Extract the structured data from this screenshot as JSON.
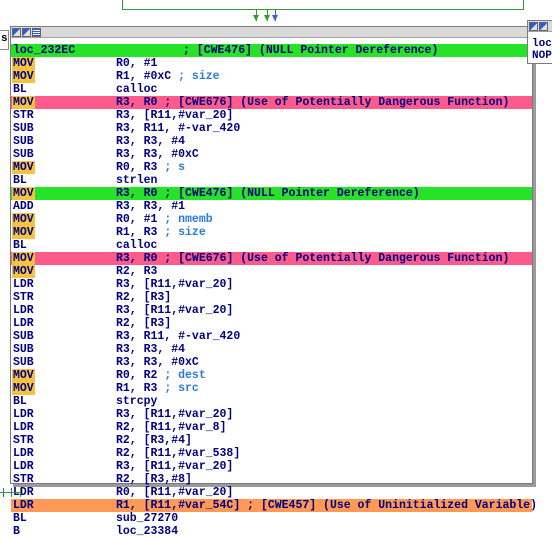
{
  "left_node": {
    "label": "s"
  },
  "main_node": {
    "lines": [
      {
        "mnemonic": "loc_232EC",
        "operand": "",
        "comment": "; [CWE476] (NULL Pointer Dereference)",
        "highlight": "green",
        "is_label": true
      },
      {
        "mnemonic": "MOV",
        "operand": "R0, #1",
        "comment": "",
        "highlight": "none",
        "mnem_box": true
      },
      {
        "mnemonic": "MOV",
        "operand": "R1, #0xC",
        "comment": "; size",
        "highlight": "none",
        "mnem_box": true
      },
      {
        "mnemonic": "BL",
        "operand": "calloc",
        "comment": "",
        "highlight": "none"
      },
      {
        "mnemonic": "MOV",
        "operand": "R3, R0",
        "comment": "; [CWE676] (Use of Potentially Dangerous Function)",
        "highlight": "pink",
        "mnem_box": true
      },
      {
        "mnemonic": "STR",
        "operand": "R3, [R11,#var_20]",
        "comment": "",
        "highlight": "none"
      },
      {
        "mnemonic": "SUB",
        "operand": "R3, R11, #-var_420",
        "comment": "",
        "highlight": "none"
      },
      {
        "mnemonic": "SUB",
        "operand": "R3, R3, #4",
        "comment": "",
        "highlight": "none"
      },
      {
        "mnemonic": "SUB",
        "operand": "R3, R3, #0xC",
        "comment": "",
        "highlight": "none"
      },
      {
        "mnemonic": "MOV",
        "operand": "R0, R3",
        "comment": "; s",
        "highlight": "none",
        "mnem_box": true
      },
      {
        "mnemonic": "BL",
        "operand": "strlen",
        "comment": "",
        "highlight": "none"
      },
      {
        "mnemonic": "MOV",
        "operand": "R3, R0",
        "comment": "; [CWE476] (NULL Pointer Dereference)",
        "highlight": "green",
        "mnem_box": true
      },
      {
        "mnemonic": "ADD",
        "operand": "R3, R3, #1",
        "comment": "",
        "highlight": "none"
      },
      {
        "mnemonic": "MOV",
        "operand": "R0, #1",
        "comment": "; nmemb",
        "highlight": "none",
        "mnem_box": true
      },
      {
        "mnemonic": "MOV",
        "operand": "R1, R3",
        "comment": "; size",
        "highlight": "none",
        "mnem_box": true
      },
      {
        "mnemonic": "BL",
        "operand": "calloc",
        "comment": "",
        "highlight": "none"
      },
      {
        "mnemonic": "MOV",
        "operand": "R3, R0",
        "comment": "; [CWE676] (Use of Potentially Dangerous Function)",
        "highlight": "pink",
        "mnem_box": true
      },
      {
        "mnemonic": "MOV",
        "operand": "R2, R3",
        "comment": "",
        "highlight": "none",
        "mnem_box": true
      },
      {
        "mnemonic": "LDR",
        "operand": "R3, [R11,#var_20]",
        "comment": "",
        "highlight": "none"
      },
      {
        "mnemonic": "STR",
        "operand": "R2, [R3]",
        "comment": "",
        "highlight": "none"
      },
      {
        "mnemonic": "LDR",
        "operand": "R3, [R11,#var_20]",
        "comment": "",
        "highlight": "none"
      },
      {
        "mnemonic": "LDR",
        "operand": "R2, [R3]",
        "comment": "",
        "highlight": "none"
      },
      {
        "mnemonic": "SUB",
        "operand": "R3, R11, #-var_420",
        "comment": "",
        "highlight": "none"
      },
      {
        "mnemonic": "SUB",
        "operand": "R3, R3, #4",
        "comment": "",
        "highlight": "none"
      },
      {
        "mnemonic": "SUB",
        "operand": "R3, R3, #0xC",
        "comment": "",
        "highlight": "none"
      },
      {
        "mnemonic": "MOV",
        "operand": "R0, R2",
        "comment": "; dest",
        "highlight": "none",
        "mnem_box": true
      },
      {
        "mnemonic": "MOV",
        "operand": "R1, R3",
        "comment": "; src",
        "highlight": "none",
        "mnem_box": true
      },
      {
        "mnemonic": "BL",
        "operand": "strcpy",
        "comment": "",
        "highlight": "none"
      },
      {
        "mnemonic": "LDR",
        "operand": "R3, [R11,#var_20]",
        "comment": "",
        "highlight": "none"
      },
      {
        "mnemonic": "LDR",
        "operand": "R2, [R11,#var_8]",
        "comment": "",
        "highlight": "none"
      },
      {
        "mnemonic": "STR",
        "operand": "R2, [R3,#4]",
        "comment": "",
        "highlight": "none"
      },
      {
        "mnemonic": "LDR",
        "operand": "R2, [R11,#var_538]",
        "comment": "",
        "highlight": "none"
      },
      {
        "mnemonic": "LDR",
        "operand": "R3, [R11,#var_20]",
        "comment": "",
        "highlight": "none"
      },
      {
        "mnemonic": "STR",
        "operand": "R2, [R3,#8]",
        "comment": "",
        "highlight": "none"
      },
      {
        "mnemonic": "LDR",
        "operand": "R0, [R11,#var_20]",
        "comment": "",
        "highlight": "none"
      },
      {
        "mnemonic": "LDR",
        "operand": "R1, [R11,#var_54C]",
        "comment": "; [CWE457] (Use of Uninitialized Variable)",
        "highlight": "orange"
      },
      {
        "mnemonic": "BL",
        "operand": "sub_27270",
        "comment": "",
        "highlight": "none"
      },
      {
        "mnemonic": "B",
        "operand": "loc_23384",
        "comment": "",
        "highlight": "none"
      }
    ]
  },
  "right_node": {
    "lines": [
      "loc_",
      "NOP"
    ]
  },
  "colors": {
    "green": "#27e327",
    "pink": "#ff5a8c",
    "orange": "#ff9955",
    "edge_green": "#2e9c2e",
    "edge_blue": "#3a5fcd"
  },
  "icons": [
    "node-color-icon",
    "node-graph-icon",
    "node-list-icon"
  ]
}
